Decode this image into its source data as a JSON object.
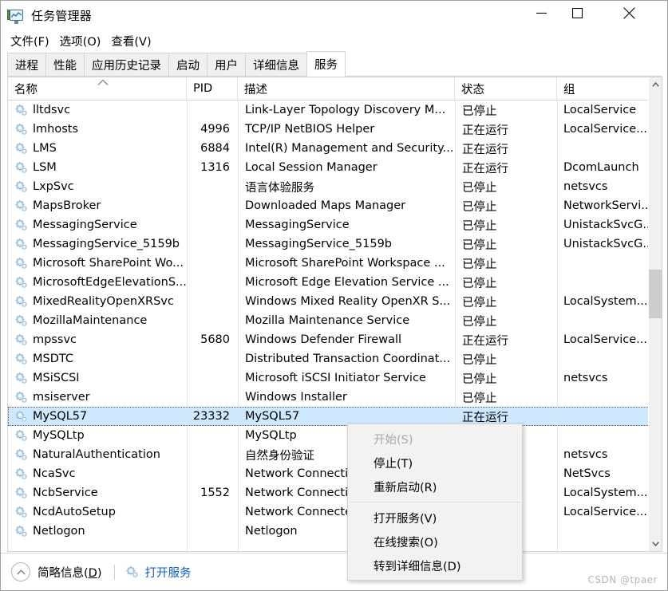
{
  "window": {
    "title": "任务管理器",
    "icon": "task-manager-icon",
    "controls": {
      "minimize": "—",
      "maximize": "□",
      "close": "✕"
    }
  },
  "menubar": [
    {
      "label": "文件(F)"
    },
    {
      "label": "选项(O)"
    },
    {
      "label": "查看(V)"
    }
  ],
  "tabs": [
    {
      "label": "进程",
      "active": false
    },
    {
      "label": "性能",
      "active": false
    },
    {
      "label": "应用历史记录",
      "active": false
    },
    {
      "label": "启动",
      "active": false
    },
    {
      "label": "用户",
      "active": false
    },
    {
      "label": "详细信息",
      "active": false
    },
    {
      "label": "服务",
      "active": true
    }
  ],
  "table": {
    "columns": [
      {
        "key": "name",
        "label": "名称",
        "sort": "asc"
      },
      {
        "key": "pid",
        "label": "PID",
        "sort": ""
      },
      {
        "key": "description",
        "label": "描述",
        "sort": ""
      },
      {
        "key": "status",
        "label": "状态",
        "sort": ""
      },
      {
        "key": "group",
        "label": "组",
        "sort": ""
      }
    ],
    "sort_indicator": "▲",
    "rows": [
      {
        "name": "lltdsvc",
        "pid": "",
        "description": "Link-Layer Topology Discovery M...",
        "status": "已停止",
        "group": "LocalService",
        "selected": false
      },
      {
        "name": "lmhosts",
        "pid": "4996",
        "description": "TCP/IP NetBIOS Helper",
        "status": "正在运行",
        "group": "LocalService...",
        "selected": false
      },
      {
        "name": "LMS",
        "pid": "6884",
        "description": "Intel(R) Management and Security...",
        "status": "正在运行",
        "group": "",
        "selected": false
      },
      {
        "name": "LSM",
        "pid": "1316",
        "description": "Local Session Manager",
        "status": "正在运行",
        "group": "DcomLaunch",
        "selected": false
      },
      {
        "name": "LxpSvc",
        "pid": "",
        "description": "语言体验服务",
        "status": "已停止",
        "group": "netsvcs",
        "selected": false
      },
      {
        "name": "MapsBroker",
        "pid": "",
        "description": "Downloaded Maps Manager",
        "status": "已停止",
        "group": "NetworkServi...",
        "selected": false
      },
      {
        "name": "MessagingService",
        "pid": "",
        "description": "MessagingService",
        "status": "已停止",
        "group": "UnistackSvcG...",
        "selected": false
      },
      {
        "name": "MessagingService_5159b",
        "pid": "",
        "description": "MessagingService_5159b",
        "status": "已停止",
        "group": "UnistackSvcG...",
        "selected": false
      },
      {
        "name": "Microsoft SharePoint Wo...",
        "pid": "",
        "description": "Microsoft SharePoint Workspace ...",
        "status": "已停止",
        "group": "",
        "selected": false
      },
      {
        "name": "MicrosoftEdgeElevationS...",
        "pid": "",
        "description": "Microsoft Edge Elevation Service ...",
        "status": "已停止",
        "group": "",
        "selected": false
      },
      {
        "name": "MixedRealityOpenXRSvc",
        "pid": "",
        "description": "Windows Mixed Reality OpenXR S...",
        "status": "已停止",
        "group": "LocalSystem...",
        "selected": false
      },
      {
        "name": "MozillaMaintenance",
        "pid": "",
        "description": "Mozilla Maintenance Service",
        "status": "已停止",
        "group": "",
        "selected": false
      },
      {
        "name": "mpssvc",
        "pid": "5680",
        "description": "Windows Defender Firewall",
        "status": "正在运行",
        "group": "LocalService...",
        "selected": false
      },
      {
        "name": "MSDTC",
        "pid": "",
        "description": "Distributed Transaction Coordinat...",
        "status": "已停止",
        "group": "",
        "selected": false
      },
      {
        "name": "MSiSCSI",
        "pid": "",
        "description": "Microsoft iSCSI Initiator Service",
        "status": "已停止",
        "group": "netsvcs",
        "selected": false
      },
      {
        "name": "msiserver",
        "pid": "",
        "description": "Windows Installer",
        "status": "已停止",
        "group": "",
        "selected": false
      },
      {
        "name": "MySQL57",
        "pid": "23332",
        "description": "MySQL57",
        "status": "正在运行",
        "group": "",
        "selected": true
      },
      {
        "name": "MySQLtp",
        "pid": "",
        "description": "MySQLtp",
        "status": "",
        "group": "",
        "selected": false
      },
      {
        "name": "NaturalAuthentication",
        "pid": "",
        "description": "自然身份验证",
        "status": "",
        "group": "netsvcs",
        "selected": false
      },
      {
        "name": "NcaSvc",
        "pid": "",
        "description": "Network Connectivity Assistant",
        "status": "",
        "group": "NetSvcs",
        "selected": false
      },
      {
        "name": "NcbService",
        "pid": "1552",
        "description": "Network Connection Broker",
        "status": "",
        "group": "LocalSystem...",
        "selected": false
      },
      {
        "name": "NcdAutoSetup",
        "pid": "",
        "description": "Network Connected Devices Auto...",
        "status": "",
        "group": "LocalService...",
        "selected": false
      },
      {
        "name": "Netlogon",
        "pid": "",
        "description": "Netlogon",
        "status": "",
        "group": "",
        "selected": false
      }
    ]
  },
  "context_menu": {
    "items": [
      {
        "label": "开始(S)",
        "disabled": true,
        "separator_after": false
      },
      {
        "label": "停止(T)",
        "disabled": false,
        "separator_after": false
      },
      {
        "label": "重新启动(R)",
        "disabled": false,
        "separator_after": true
      },
      {
        "label": "打开服务(V)",
        "disabled": false,
        "separator_after": false
      },
      {
        "label": "在线搜索(O)",
        "disabled": false,
        "separator_after": false
      },
      {
        "label": "转到详细信息(D)",
        "disabled": false,
        "separator_after": false
      }
    ]
  },
  "statusbar": {
    "fewer_details": "简略信息(D)",
    "fewer_details_accel": "D",
    "open_services": "打开服务",
    "open_services_icon": "service-gear-icon",
    "watermark": "CSDN @tpaer"
  },
  "colors": {
    "selection": "#cde8ff",
    "link": "#0f5fbd",
    "scrollbar_thumb": "#cdcdcd",
    "scrollbar_track": "#f0f0f0",
    "window_bg": "#ffffff",
    "tab_inactive": "#f0f0f0",
    "menu_bg": "#f2f2f2",
    "disabled_text": "#a8a8a8"
  },
  "scrollbar": {
    "thumb_top_pct": 40,
    "thumb_height_pct": 11
  }
}
